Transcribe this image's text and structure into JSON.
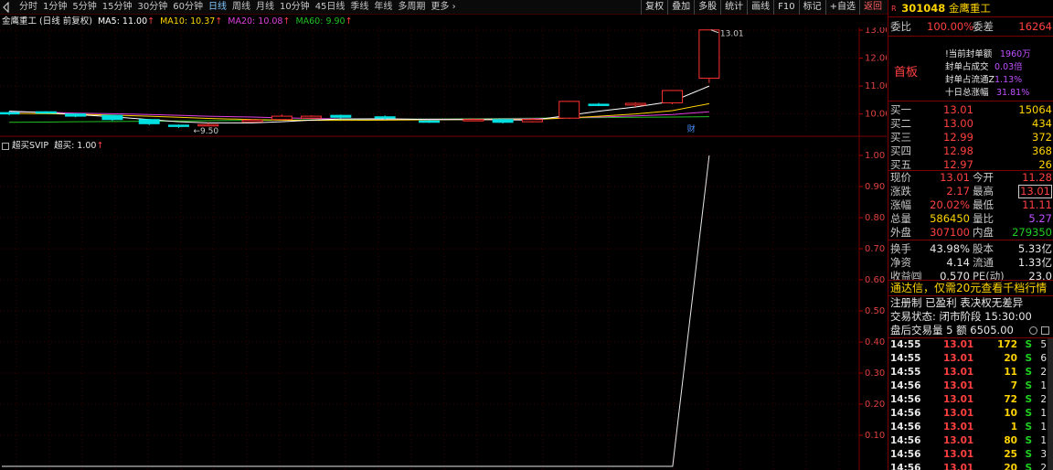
{
  "toolbar": {
    "timeframes": [
      "分时",
      "1分钟",
      "5分钟",
      "15分钟",
      "30分钟",
      "60分钟",
      "日线",
      "周线",
      "月线",
      "10分钟",
      "45日线",
      "季线",
      "年线",
      "多周期"
    ],
    "active_timeframe": "日线",
    "more_label": "更多",
    "buttons": [
      "复权",
      "叠加",
      "多股",
      "统计",
      "画线",
      "F10",
      "标记",
      "+自选",
      "返回"
    ]
  },
  "price_chart": {
    "title": "金鹰重工 (日线 前复权)",
    "ma5": "MA5: 11.00",
    "ma10": "MA10: 10.37",
    "ma20": "MA20: 10.08",
    "ma60": "MA60: 9.90",
    "y_ticks": [
      "13.00",
      "12.00",
      "11.00",
      "10.00"
    ],
    "high_label": "13.01",
    "low_label": "9.50",
    "badge": "财",
    "colors": {
      "up": "#ff3030",
      "down": "#00e0e0",
      "ma5": "#ffffff",
      "ma10": "#ffd400",
      "ma20": "#e040e0",
      "ma60": "#20c020"
    }
  },
  "sub_chart": {
    "title": "超买SVIP",
    "value": "超买: 1.00",
    "y_ticks": [
      "1.00",
      "0.90",
      "0.80",
      "0.70",
      "0.60",
      "0.50",
      "0.40",
      "0.30",
      "0.20",
      "0.10"
    ]
  },
  "chart_data": {
    "type": "candlestick",
    "x_range": [
      0,
      40
    ],
    "y_range": [
      9.3,
      13.1
    ],
    "candles": [
      {
        "o": 10.05,
        "c": 10.0,
        "h": 10.1,
        "l": 9.95
      },
      {
        "o": 10.08,
        "c": 10.03,
        "h": 10.1,
        "l": 10.0
      },
      {
        "o": 10.0,
        "c": 9.92,
        "h": 10.02,
        "l": 9.88
      },
      {
        "o": 9.95,
        "c": 9.8,
        "h": 9.97,
        "l": 9.75
      },
      {
        "o": 9.8,
        "c": 9.65,
        "h": 9.82,
        "l": 9.6
      },
      {
        "o": 9.6,
        "c": 9.55,
        "h": 9.62,
        "l": 9.5
      },
      {
        "o": 9.6,
        "c": 9.62,
        "h": 9.68,
        "l": 9.55
      },
      {
        "o": 9.72,
        "c": 9.78,
        "h": 9.82,
        "l": 9.7
      },
      {
        "o": 9.8,
        "c": 9.92,
        "h": 9.98,
        "l": 9.78
      },
      {
        "o": 9.85,
        "c": 9.92,
        "h": 9.95,
        "l": 9.82
      },
      {
        "o": 9.95,
        "c": 9.88,
        "h": 9.98,
        "l": 9.84
      },
      {
        "o": 9.9,
        "c": 9.85,
        "h": 9.95,
        "l": 9.8
      },
      {
        "o": 9.75,
        "c": 9.72,
        "h": 9.78,
        "l": 9.68
      },
      {
        "o": 9.78,
        "c": 9.8,
        "h": 9.85,
        "l": 9.74
      },
      {
        "o": 9.8,
        "c": 9.7,
        "h": 9.82,
        "l": 9.66
      },
      {
        "o": 9.72,
        "c": 9.8,
        "h": 9.86,
        "l": 9.7
      },
      {
        "o": 9.85,
        "c": 10.45,
        "h": 10.47,
        "l": 9.82
      },
      {
        "o": 10.35,
        "c": 10.32,
        "h": 10.4,
        "l": 10.28
      },
      {
        "o": 10.32,
        "c": 10.38,
        "h": 10.42,
        "l": 10.25
      },
      {
        "o": 10.4,
        "c": 10.84,
        "h": 10.86,
        "l": 10.35
      },
      {
        "o": 11.28,
        "c": 13.01,
        "h": 13.01,
        "l": 11.11
      }
    ],
    "candle_x": [
      0.5,
      3,
      5,
      7.5,
      10,
      12,
      14,
      17,
      19,
      21,
      23,
      26,
      29,
      32,
      34,
      36,
      38.5,
      40.5,
      43,
      45.5,
      48
    ],
    "ma5": [
      10.1,
      10.05,
      9.98,
      9.9,
      9.8,
      9.72,
      9.68,
      9.68,
      9.72,
      9.78,
      9.82,
      9.83,
      9.8,
      9.8,
      9.79,
      9.78,
      9.95,
      10.1,
      10.25,
      10.45,
      11.0
    ],
    "ma10": [
      10.02,
      10.01,
      9.99,
      9.96,
      9.92,
      9.88,
      9.84,
      9.8,
      9.78,
      9.77,
      9.77,
      9.78,
      9.79,
      9.8,
      9.8,
      9.8,
      9.86,
      9.92,
      10.0,
      10.12,
      10.37
    ],
    "ma20": [
      10.08,
      10.06,
      10.03,
      10.01,
      9.98,
      9.95,
      9.92,
      9.89,
      9.86,
      9.84,
      9.82,
      9.81,
      9.81,
      9.81,
      9.82,
      9.83,
      9.86,
      9.89,
      9.93,
      9.98,
      10.08
    ],
    "ma60": [
      9.7,
      9.71,
      9.72,
      9.73,
      9.74,
      9.75,
      9.76,
      9.77,
      9.78,
      9.79,
      9.8,
      9.81,
      9.82,
      9.83,
      9.84,
      9.85,
      9.86,
      9.87,
      9.88,
      9.89,
      9.9
    ],
    "indicator": [
      0,
      0,
      0,
      0,
      0,
      0,
      0,
      0,
      0,
      0,
      0,
      0,
      0,
      0,
      0,
      0,
      0,
      0,
      0,
      0,
      1.0
    ]
  },
  "panel": {
    "code": "301048",
    "name": "金鹰重工",
    "code_prefix": "R",
    "weibi_label": "委比",
    "weibi_value": "100.00%",
    "weicha_label": "委差",
    "weicha_value": "16264",
    "shouban": "首板",
    "seal_info": [
      {
        "label": "!当前封单额",
        "value": "1960万"
      },
      {
        "label": "封单占成交",
        "value": "0.03倍"
      },
      {
        "label": "封单占流通Z",
        "value": "1.13%"
      },
      {
        "label": "十日总涨幅",
        "value": "31.81%"
      }
    ],
    "bids": [
      {
        "label": "买一",
        "price": "13.01",
        "vol": "15064"
      },
      {
        "label": "买二",
        "price": "13.00",
        "vol": "434"
      },
      {
        "label": "买三",
        "price": "12.99",
        "vol": "372"
      },
      {
        "label": "买四",
        "price": "12.98",
        "vol": "368"
      },
      {
        "label": "买五",
        "price": "12.97",
        "vol": "26"
      }
    ],
    "quotes": [
      {
        "l1": "现价",
        "v1": "13.01",
        "l2": "今开",
        "v2": "11.28"
      },
      {
        "l1": "涨跌",
        "v1": "2.17",
        "l2": "最高",
        "v2": "13.01"
      },
      {
        "l1": "涨幅",
        "v1": "20.02%",
        "l2": "最低",
        "v2": "11.11"
      },
      {
        "l1": "总量",
        "v1": "586450",
        "l2": "量比",
        "v2": "5.27"
      },
      {
        "l1": "外盘",
        "v1": "307100",
        "l2": "内盘",
        "v2": "279350"
      },
      {
        "l1": "换手",
        "v1": "43.98%",
        "l2": "股本",
        "v2": "5.33亿"
      },
      {
        "l1": "净资",
        "v1": "4.14",
        "l2": "流通",
        "v2": "1.33亿"
      },
      {
        "l1": "收益㈣",
        "v1": "0.570",
        "l2": "PE(动)",
        "v2": "23.0"
      }
    ],
    "promo": "通达信，仅需20元查看千档行情",
    "reg_line": "注册制 已盈利 表决权无差异",
    "trade_state": "交易状态: 闭市阶段 15:30:00",
    "after_hours": "盘后交易量 5 额 6505.00",
    "ticks": [
      {
        "time": "14:55",
        "price": "13.01",
        "vol": "172",
        "side": "S",
        "n": "5"
      },
      {
        "time": "14:55",
        "price": "13.01",
        "vol": "20",
        "side": "S",
        "n": "6"
      },
      {
        "time": "14:55",
        "price": "13.01",
        "vol": "11",
        "side": "S",
        "n": "2"
      },
      {
        "time": "14:56",
        "price": "13.01",
        "vol": "7",
        "side": "S",
        "n": "1"
      },
      {
        "time": "14:56",
        "price": "13.01",
        "vol": "72",
        "side": "S",
        "n": "2"
      },
      {
        "time": "14:56",
        "price": "13.01",
        "vol": "10",
        "side": "S",
        "n": "1"
      },
      {
        "time": "14:56",
        "price": "13.01",
        "vol": "1",
        "side": "S",
        "n": "1"
      },
      {
        "time": "14:56",
        "price": "13.01",
        "vol": "80",
        "side": "S",
        "n": "1"
      },
      {
        "time": "14:56",
        "price": "13.01",
        "vol": "25",
        "side": "S",
        "n": "3"
      },
      {
        "time": "14:56",
        "price": "13.01",
        "vol": "20",
        "side": "S",
        "n": "2"
      }
    ]
  }
}
